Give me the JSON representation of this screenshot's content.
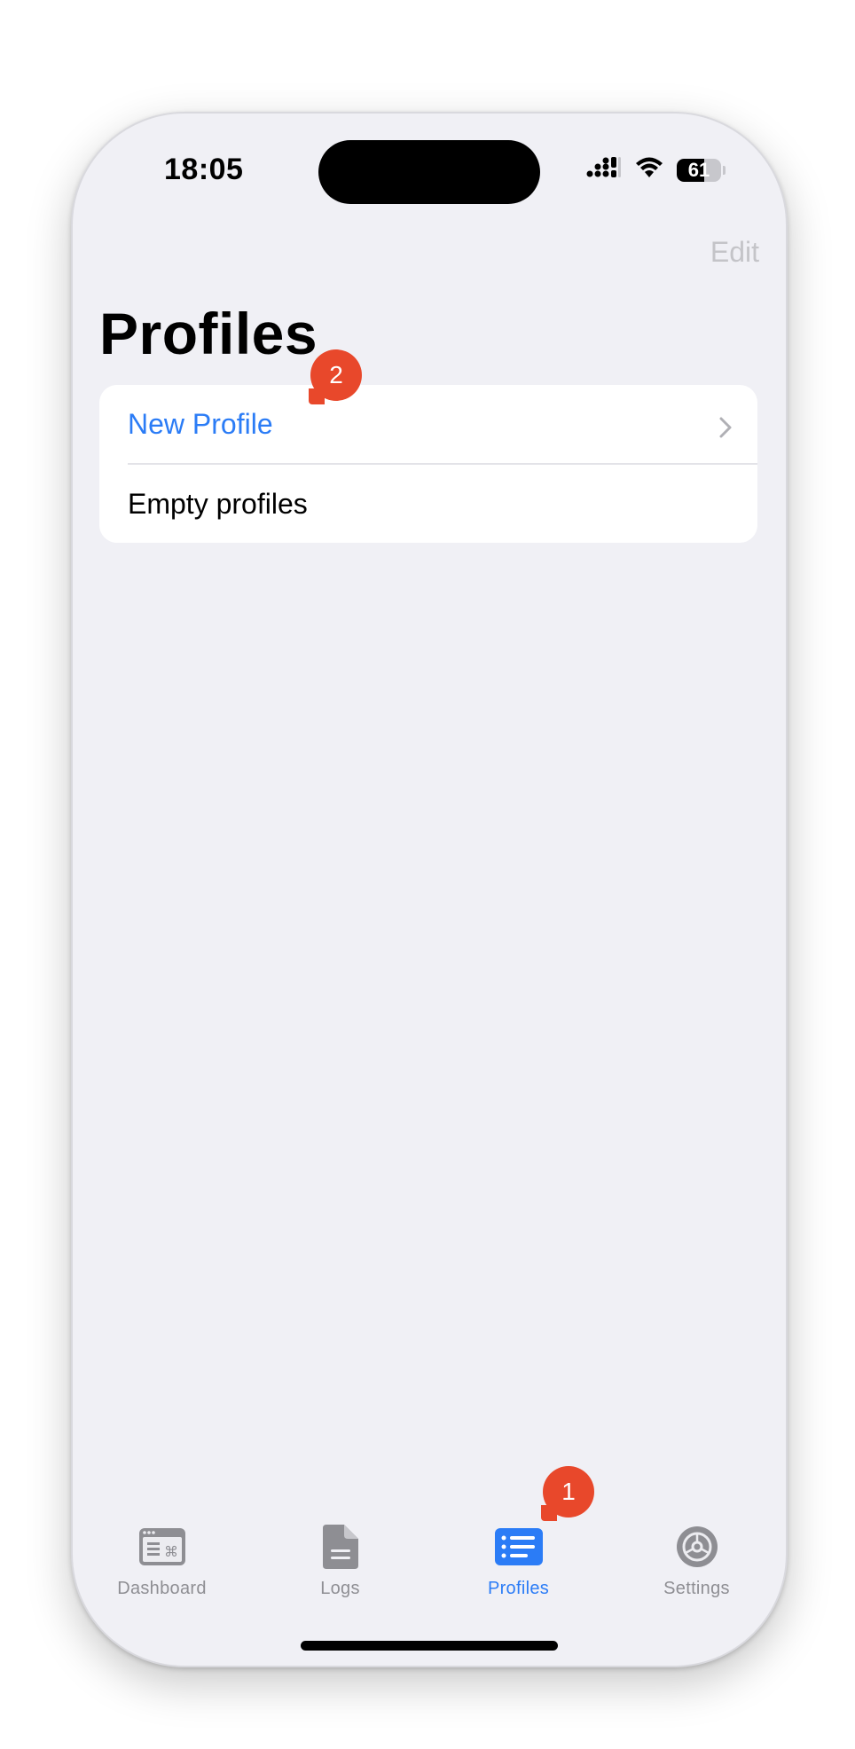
{
  "status_bar": {
    "time": "18:05",
    "battery": "61",
    "battery_level": 0.61,
    "icons": [
      "cellular-signal-icon",
      "wifi-icon",
      "battery-icon"
    ]
  },
  "nav": {
    "edit_label": "Edit",
    "title": "Profiles"
  },
  "list": {
    "rows": [
      {
        "label": "New Profile",
        "style": "link",
        "chevron": true
      },
      {
        "label": "Empty profiles",
        "style": "plain",
        "chevron": false
      }
    ]
  },
  "annotations": [
    {
      "number": "1",
      "target": "tab-profiles"
    },
    {
      "number": "2",
      "target": "new-profile-row"
    }
  ],
  "tabs": [
    {
      "label": "Dashboard",
      "icon": "dashboard-icon",
      "active": false
    },
    {
      "label": "Logs",
      "icon": "document-icon",
      "active": false
    },
    {
      "label": "Profiles",
      "icon": "list-icon",
      "active": true
    },
    {
      "label": "Settings",
      "icon": "gear-icon",
      "active": false
    }
  ],
  "colors": {
    "accent": "#2b7cf6",
    "badge": "#e8482b",
    "background": "#f0f0f5",
    "inactive_tab": "#8e8e93"
  }
}
